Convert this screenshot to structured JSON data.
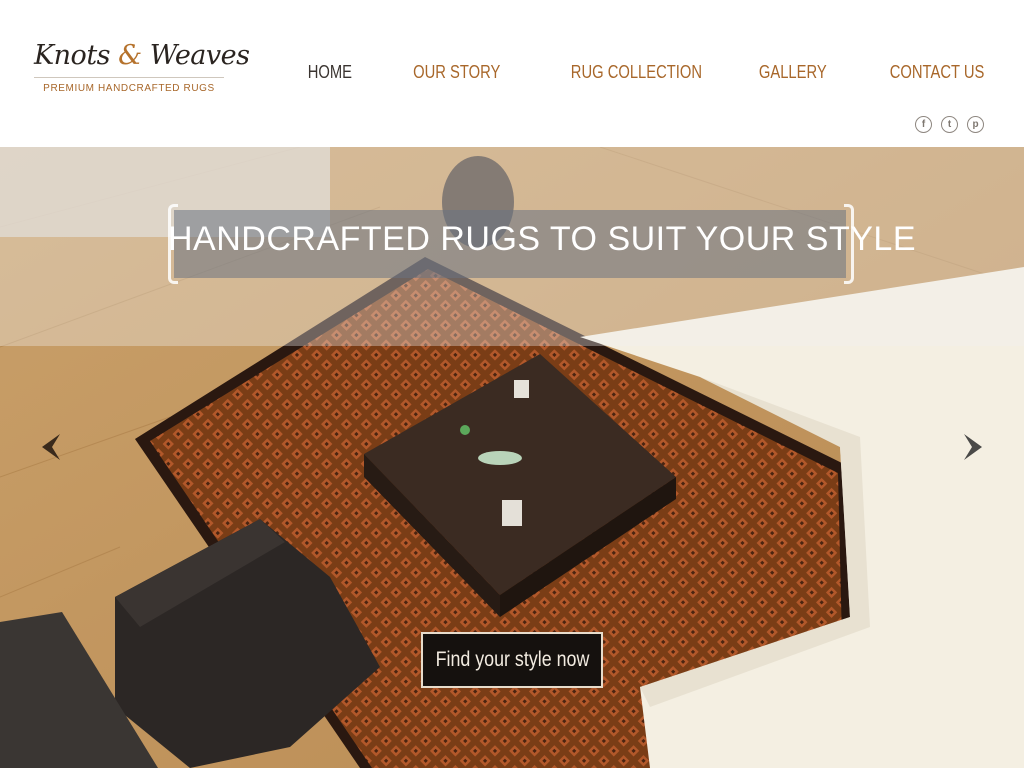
{
  "brand": {
    "name_part1": "Knots",
    "ampersand": "&",
    "name_part2": "Weaves",
    "tagline": "PREMIUM HANDCRAFTED RUGS"
  },
  "nav": {
    "items": [
      {
        "label": "HOME",
        "active": true
      },
      {
        "label": "OUR STORY",
        "active": false
      },
      {
        "label": "RUG COLLECTION",
        "active": false
      },
      {
        "label": "GALLERY",
        "active": false
      },
      {
        "label": "CONTACT US",
        "active": false
      }
    ]
  },
  "social": {
    "facebook": "f",
    "twitter": "t",
    "pinterest": "p"
  },
  "hero": {
    "headline": "HANDCRAFTED RUGS TO SUIT YOUR STYLE",
    "cta_label": "Find your style now"
  },
  "colors": {
    "accent": "#a8672a",
    "nav_active": "#3a3430",
    "cta_bg": "#15110e"
  }
}
